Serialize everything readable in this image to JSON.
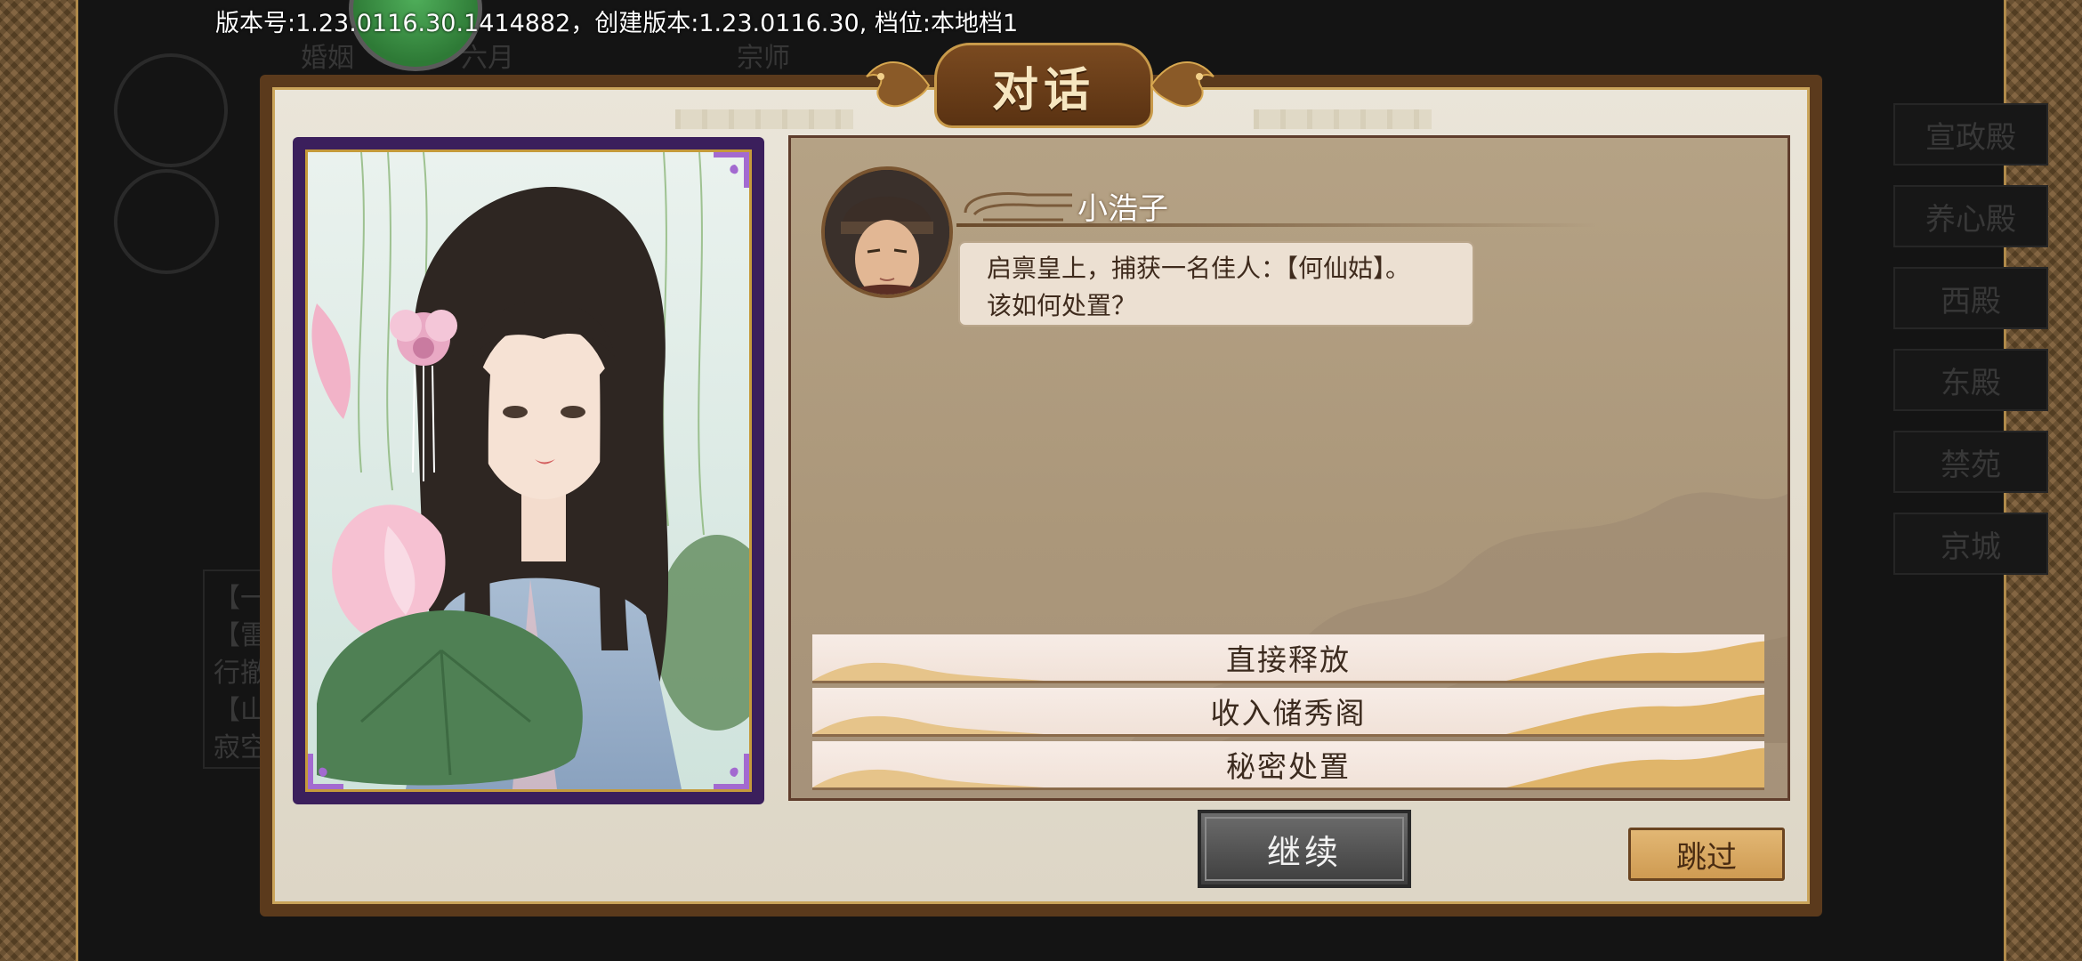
{
  "version_bar": {
    "text": "版本号:1.23.0116.30.1414882，创建版本:1.23.0116.30, 档位:本地档1"
  },
  "background": {
    "top_items": [
      "婚姻",
      "六月",
      "宗师"
    ],
    "right_menu": [
      "宣政殿",
      "养心殿",
      "西殿",
      "东殿",
      "禁苑",
      "京城"
    ],
    "left_panel": [
      "【一名小",
      "【雷照花",
      "行撤",
      "【山日太",
      "寂空和尚"
    ]
  },
  "dialog": {
    "title": "对话",
    "speaker": {
      "name": "小浩子"
    },
    "message": {
      "line1": "启禀皇上，捕获一名佳人：【何仙姑】。",
      "line2": "该如何处置？"
    },
    "choices": [
      {
        "label": "直接释放"
      },
      {
        "label": "收入储秀阁"
      },
      {
        "label": "秘密处置"
      }
    ],
    "continue_label": "继续",
    "skip_label": "跳过"
  },
  "colors": {
    "portrait_frame": "#3b1f5c",
    "portrait_border": "#c59a3a",
    "dialogue_panel": "#b5a285",
    "skip_button": "#d9a862",
    "continue_button": "#555555"
  }
}
